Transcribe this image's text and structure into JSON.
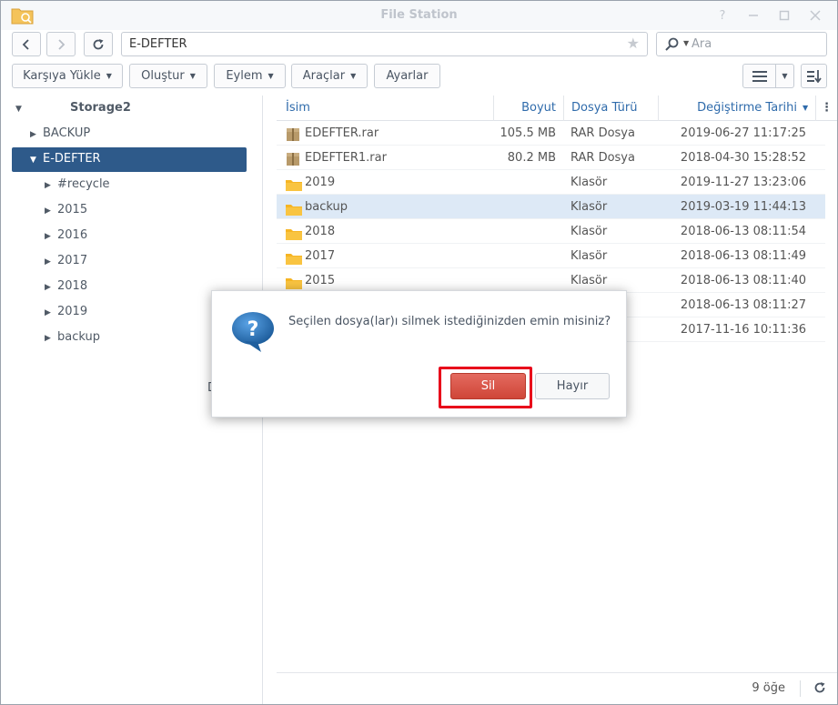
{
  "window": {
    "title": "File Station"
  },
  "nav": {
    "path": "E-DEFTER",
    "search_placeholder": "Ara"
  },
  "toolbar": {
    "upload": "Karşıya Yükle",
    "create": "Oluştur",
    "action": "Eylem",
    "tools": "Araçlar",
    "settings": "Ayarlar"
  },
  "tree": {
    "root": "Storage2",
    "items": [
      {
        "label": "BACKUP"
      },
      {
        "label": "E-DEFTER"
      },
      {
        "label": "#recycle"
      },
      {
        "label": "2015"
      },
      {
        "label": "2016"
      },
      {
        "label": "2017"
      },
      {
        "label": "2018"
      },
      {
        "label": "2019"
      },
      {
        "label": "backup"
      }
    ],
    "stray_text": "D"
  },
  "table": {
    "columns": [
      "İsim",
      "Boyut",
      "Dosya Türü",
      "Değiştirme Tarihi"
    ],
    "rows": [
      {
        "name": "EDEFTER.rar",
        "size": "105.5 MB",
        "type": "RAR Dosya",
        "date": "2019-06-27 11:17:25",
        "icon": "archive-icon"
      },
      {
        "name": "EDEFTER1.rar",
        "size": "80.2 MB",
        "type": "RAR Dosya",
        "date": "2018-04-30 15:28:52",
        "icon": "archive-icon"
      },
      {
        "name": "2019",
        "size": "",
        "type": "Klasör",
        "date": "2019-11-27 13:23:06",
        "icon": "folder-icon"
      },
      {
        "name": "backup",
        "size": "",
        "type": "Klasör",
        "date": "2019-03-19 11:44:13",
        "icon": "folder-icon"
      },
      {
        "name": "2018",
        "size": "",
        "type": "Klasör",
        "date": "2018-06-13 08:11:54",
        "icon": "folder-icon"
      },
      {
        "name": "2017",
        "size": "",
        "type": "Klasör",
        "date": "2018-06-13 08:11:49",
        "icon": "folder-icon"
      },
      {
        "name": "2015",
        "size": "",
        "type": "Klasör",
        "date": "2018-06-13 08:11:40",
        "icon": "folder-icon"
      },
      {
        "name": "",
        "size": "",
        "type": "",
        "date": "2018-06-13 08:11:27",
        "icon": ""
      },
      {
        "name": "",
        "size": "",
        "type": "",
        "date": "2017-11-16 10:11:36",
        "icon": ""
      }
    ]
  },
  "status": {
    "count": "9 öğe"
  },
  "dialog": {
    "message": "Seçilen dosya(lar)ı silmek istediğinizden emin misiniz?",
    "confirm": "Sil",
    "cancel": "Hayır"
  },
  "colors": {
    "accent": "#2e5a8a",
    "link": "#2f6bab",
    "danger": "#d9534f",
    "highlight": "#e8001a",
    "folder": "#f6b524"
  }
}
